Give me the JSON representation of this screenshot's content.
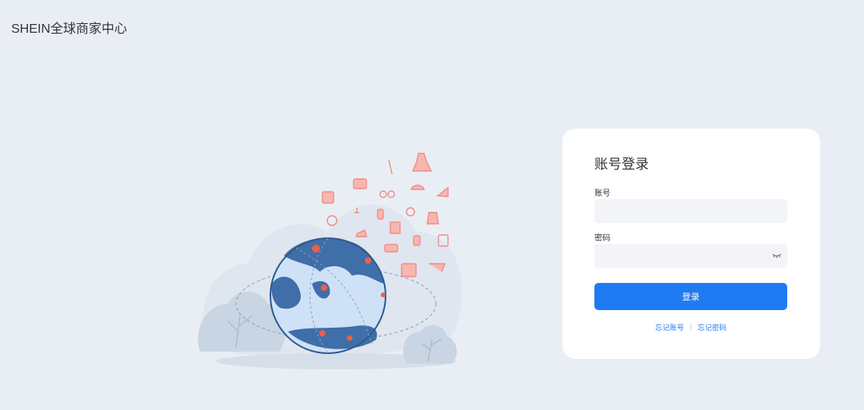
{
  "brand": {
    "title": "SHEIN全球商家中心"
  },
  "login": {
    "title": "账号登录",
    "account_label": "账号",
    "account_value": "",
    "password_label": "密码",
    "password_value": "",
    "submit_label": "登录",
    "forgot_account": "忘记账号",
    "forgot_password": "忘记密码"
  },
  "colors": {
    "background": "#e9eef5",
    "primary": "#1f7bf2",
    "card": "#ffffff",
    "globe_land": "#3f6ea8",
    "globe_ocean": "#cfe1f7",
    "icons": "#f3a29a"
  },
  "illustration": {
    "icon": "globe-with-fashion-items-illustration"
  }
}
